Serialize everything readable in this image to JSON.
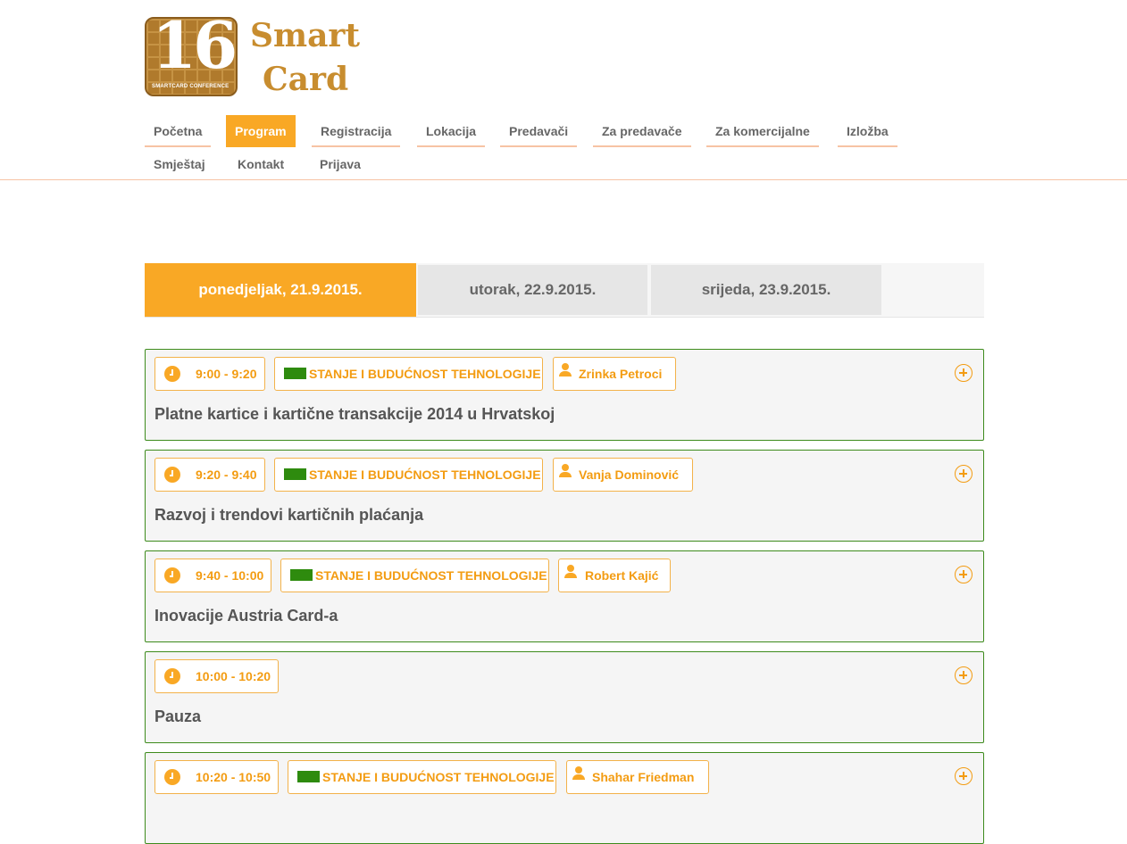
{
  "logo": {
    "number": "16",
    "caption": "SMARTCARD CONFERENCE",
    "word1": "Smart",
    "word2": "Card"
  },
  "nav": {
    "items": [
      {
        "label": "Početna"
      },
      {
        "label": "Program"
      },
      {
        "label": "Registracija"
      },
      {
        "label": "Lokacija"
      },
      {
        "label": "Predavači"
      },
      {
        "label": "Za predavače"
      },
      {
        "label": "Za komercijalne"
      },
      {
        "label": "Izložba"
      },
      {
        "label": "Smještaj"
      },
      {
        "label": "Kontakt"
      },
      {
        "label": "Prijava"
      }
    ],
    "active": "Program"
  },
  "days": [
    {
      "label": "ponedjeljak, 21.9.2015."
    },
    {
      "label": "utorak, 22.9.2015."
    },
    {
      "label": "srijeda, 23.9.2015."
    }
  ],
  "colors": {
    "accent": "#f9a825",
    "track": "#2e8b0e",
    "border": "#3d8b1c",
    "nav_underline": "#f7c3a4"
  },
  "sessions": [
    {
      "time": "9:00 - 9:20",
      "track": "STANJE I BUDUĆNOST TEHNOLOGIJE",
      "speaker": "Zrinka Petroci",
      "title": "Platne kartice i kartične transakcije 2014 u Hrvatskoj"
    },
    {
      "time": "9:20 - 9:40",
      "track": "STANJE I BUDUĆNOST TEHNOLOGIJE",
      "speaker": "Vanja Dominović",
      "title": "Razvoj i trendovi kartičnih plaćanja"
    },
    {
      "time": "9:40 - 10:00",
      "track": "STANJE I BUDUĆNOST TEHNOLOGIJE",
      "speaker": "Robert Kajić",
      "title": "Inovacije Austria Card-a"
    },
    {
      "time": "10:00 - 10:20",
      "title": "Pauza"
    },
    {
      "time": "10:20 - 10:50",
      "track": "STANJE I BUDUĆNOST TEHNOLOGIJE",
      "speaker": "Shahar Friedman",
      "title": ""
    }
  ]
}
